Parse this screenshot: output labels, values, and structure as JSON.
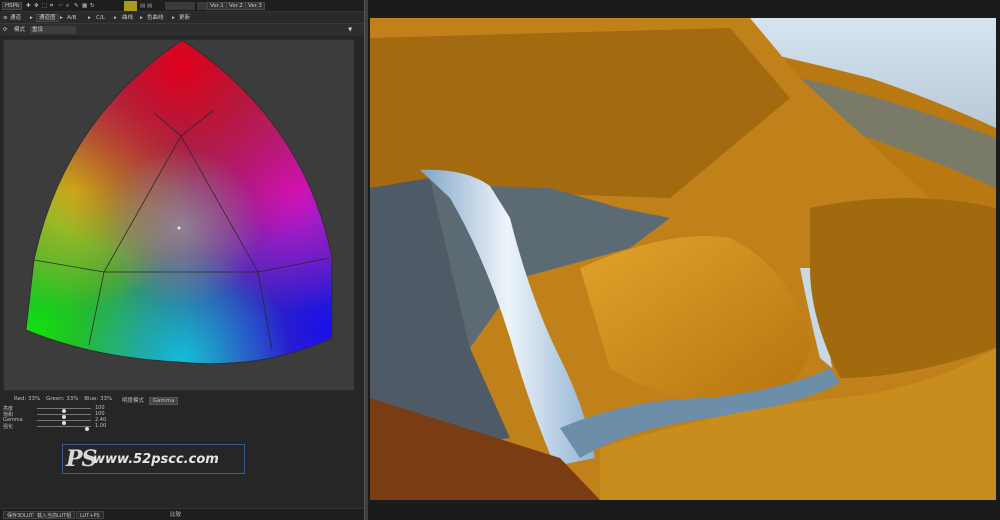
{
  "toolbar1": {
    "mode": "HSPb",
    "swatch_color": "#a89a1a",
    "version_tabs": [
      "Ver.1",
      "Ver.2",
      "Ver.3"
    ]
  },
  "toolbar2": {
    "tabs": [
      "通道",
      "通道图",
      "A/B",
      "C/L",
      "曲线",
      "色曲线",
      "更新"
    ]
  },
  "toolbar3": {
    "mode_label": "模式",
    "mode_value": "重设"
  },
  "readout": {
    "red": "Red: 33%",
    "green": "Green: 33%",
    "blue": "Blue: 33%",
    "gamma_label": "明度模式",
    "gamma_value": "Gamma"
  },
  "sliders": [
    {
      "label": "亮度",
      "value": "100",
      "pos": 0.5
    },
    {
      "label": "饱和",
      "value": "100",
      "pos": 0.5
    },
    {
      "label": "Gamma",
      "value": "2.40",
      "pos": 0.5
    },
    {
      "label": "强化",
      "value": "1.00",
      "pos": 0.92
    }
  ],
  "watermark": {
    "ps": "PS",
    "url": "www.52pscc.com"
  },
  "bottom_bar": {
    "buttons": [
      "保存3DLUT",
      "载入当前LUT组",
      "LUT+PS"
    ],
    "center_label": "比较"
  },
  "colors": {
    "panel_bg": "#262626",
    "wheel_bg": "#3c3c3c",
    "accent_swatch": "#a89a1a"
  }
}
